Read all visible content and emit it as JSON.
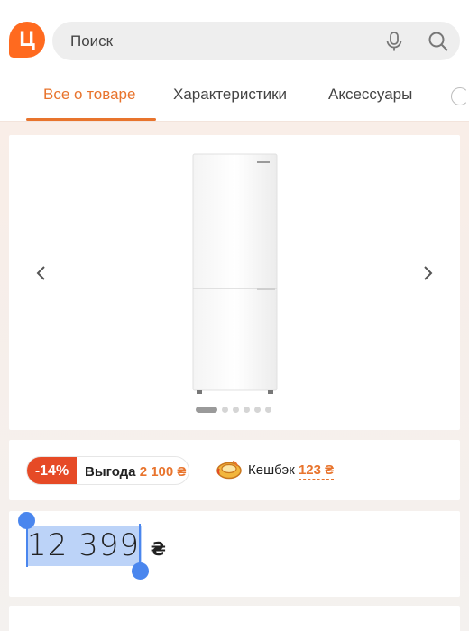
{
  "header": {
    "logo_letter": "Ц",
    "search_placeholder": "Поиск",
    "icons": {
      "mic": "microphone-icon",
      "search": "search-icon",
      "logo": "brand-logo"
    }
  },
  "tabs": [
    {
      "label": "Все о товаре",
      "active": true
    },
    {
      "label": "Характеристики",
      "active": false
    },
    {
      "label": "Аксессуары",
      "active": false
    }
  ],
  "gallery": {
    "image": "refrigerator-photo",
    "total_slides": 6,
    "active_slide": 1,
    "icons": {
      "prev": "chevron-left-icon",
      "next": "chevron-right-icon"
    }
  },
  "promo": {
    "discount": "-14%",
    "benefit_label": "Выгода",
    "benefit_amount": "2 100 ₴",
    "cashback_label": "Кешбэк",
    "cashback_amount": "123 ₴"
  },
  "price": {
    "value": "12 399",
    "currency": "₴"
  },
  "colors": {
    "accent": "#e8742d",
    "brand": "#ff6a1f",
    "discount": "#e64a26",
    "selection": "#4a86ee"
  }
}
